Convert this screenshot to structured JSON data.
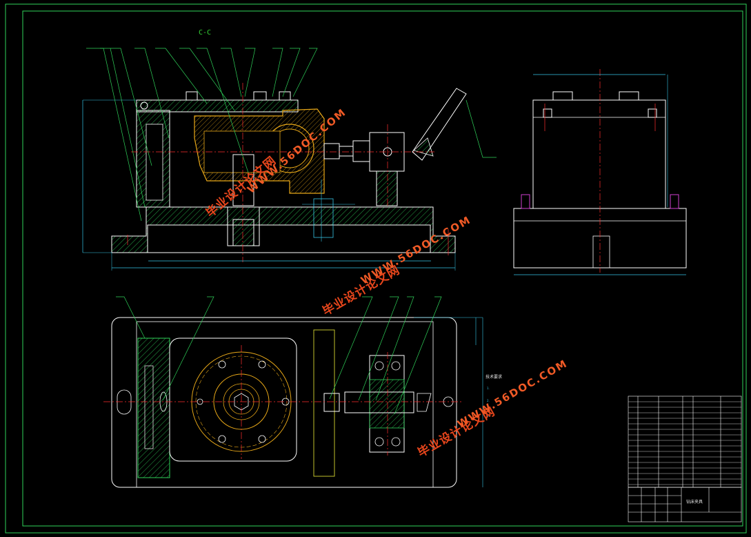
{
  "drawing": {
    "section_label": "C-C",
    "watermarks": [
      {
        "cn": "毕业设计论文网",
        "en": "WWW.56DOC.COM"
      },
      {
        "cn": "毕业设计论文网",
        "en": "WWW.56DOC.COM"
      },
      {
        "cn": "毕业设计论文网",
        "en": "WWW.56DOC.COM"
      }
    ],
    "tech_notes": {
      "title": "技术要求",
      "lines": [
        "1.",
        "2.",
        "3."
      ]
    },
    "title_block": {
      "drawing_name": "钻床夹具",
      "school": "",
      "drawing_no": ""
    }
  },
  "colors": {
    "background": "#000000",
    "border": "#2fd35a",
    "outline": "#ffffff",
    "hatch": "#2fd35a",
    "leader": "#2fd35a",
    "dimension": "#36c6e8",
    "centerline": "#ff2e2e",
    "workpiece": "#e8a818",
    "yellow_part": "#d6d630",
    "magenta": "#d040d0"
  }
}
